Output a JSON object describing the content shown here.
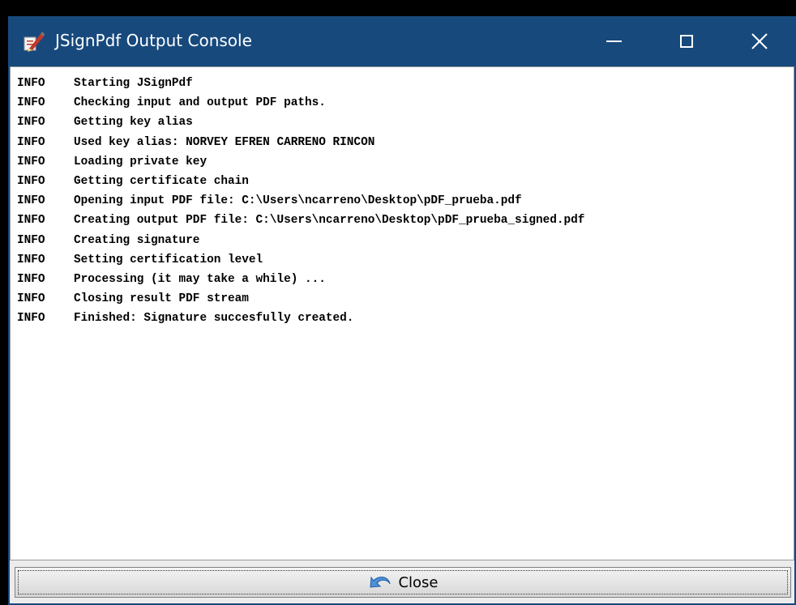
{
  "window": {
    "title": "JSignPdf Output Console",
    "icon": "jsignpdf-pen-icon",
    "controls": {
      "minimize_icon": "minimize-icon",
      "maximize_icon": "maximize-icon",
      "close_icon": "close-icon"
    },
    "title_color": "#17497d"
  },
  "console": {
    "lines": [
      {
        "level": "INFO",
        "message": "Starting JSignPdf"
      },
      {
        "level": "INFO",
        "message": "Checking input and output PDF paths."
      },
      {
        "level": "INFO",
        "message": "Getting key alias"
      },
      {
        "level": "INFO",
        "message": "Used key alias: NORVEY EFREN CARRENO RINCON"
      },
      {
        "level": "INFO",
        "message": "Loading private key"
      },
      {
        "level": "INFO",
        "message": "Getting certificate chain"
      },
      {
        "level": "INFO",
        "message": "Opening input PDF file: C:\\Users\\ncarreno\\Desktop\\pDF_prueba.pdf"
      },
      {
        "level": "INFO",
        "message": "Creating output PDF file: C:\\Users\\ncarreno\\Desktop\\pDF_prueba_signed.pdf"
      },
      {
        "level": "INFO",
        "message": "Creating signature"
      },
      {
        "level": "INFO",
        "message": "Setting certification level"
      },
      {
        "level": "INFO",
        "message": "Processing (it may take a while) ..."
      },
      {
        "level": "INFO",
        "message": "Closing result PDF stream"
      },
      {
        "level": "INFO",
        "message": "Finished: Signature succesfully created."
      }
    ]
  },
  "footer": {
    "close_label": "Close",
    "close_icon": "undo-arrow-icon"
  }
}
